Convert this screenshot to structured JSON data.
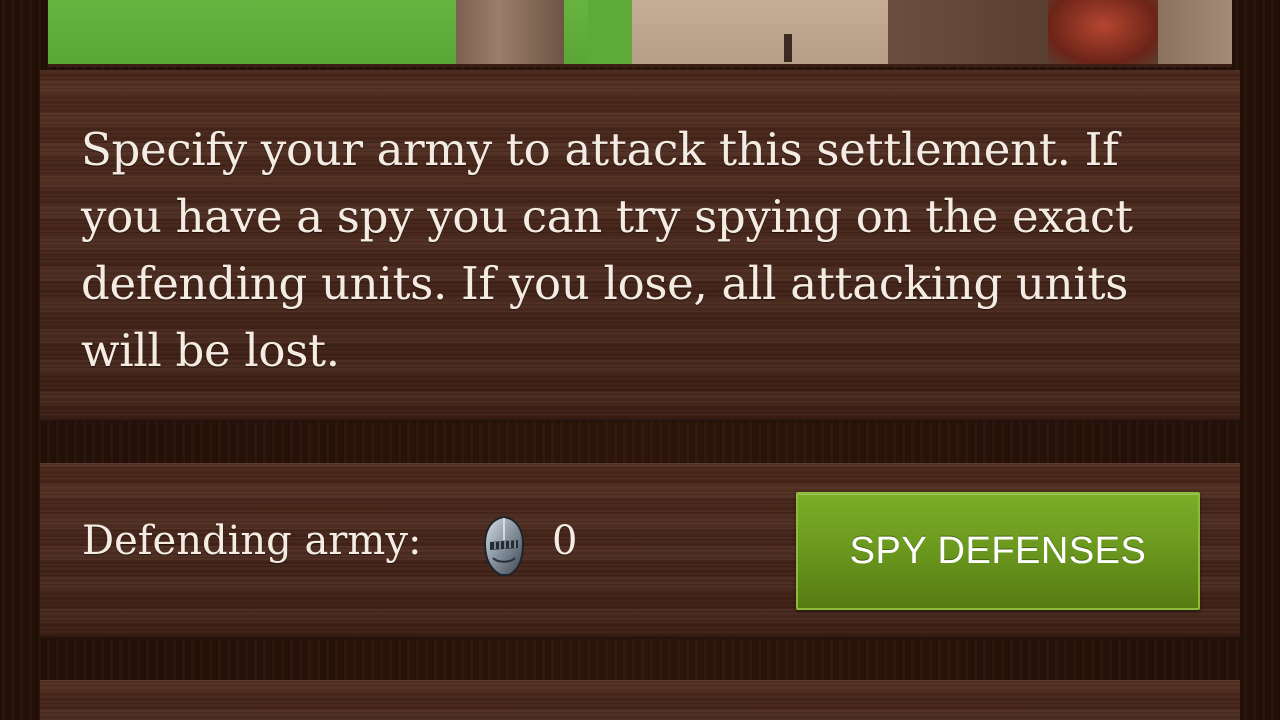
{
  "description": {
    "text": "Specify your army to attack this settlement. If you have a spy you can try spying on the exact defending units. If you lose, all attacking units will be lost."
  },
  "defending_army": {
    "label": "Defending army:",
    "icon": "knight-helmet-icon",
    "count": "0"
  },
  "spy_button": {
    "label": "SPY DEFENSES",
    "color": "#6c9a1f"
  },
  "colors": {
    "wood": "#48261a",
    "frame": "#2a130c",
    "text": "#f4ece2"
  }
}
